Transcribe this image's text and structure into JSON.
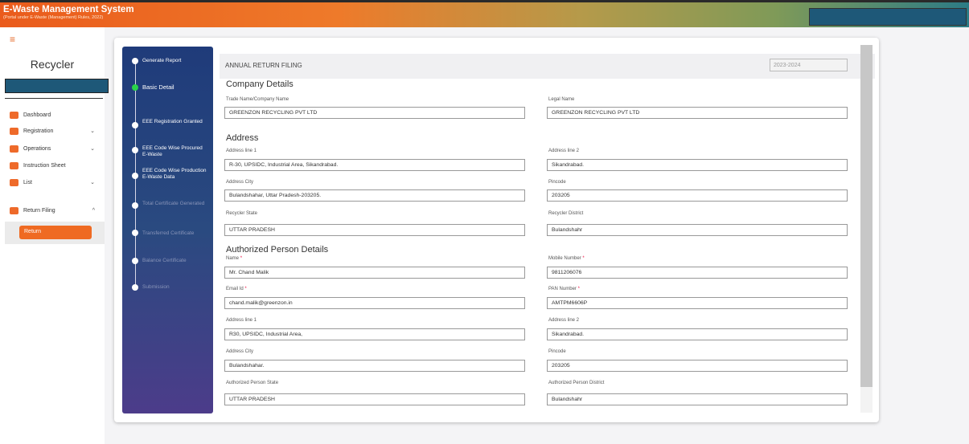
{
  "topbar": {
    "title": "E-Waste Management System",
    "subtitle": "(Portal under E-Waste (Management) Rules, 2022)"
  },
  "sidebar": {
    "menu_icon": "≡",
    "role": "Recycler",
    "items": [
      {
        "label": "Dashboard",
        "icon": "dashboard-icon"
      },
      {
        "label": "Registration",
        "icon": "envelope-icon",
        "chevron": "⌄"
      },
      {
        "label": "Operations",
        "icon": "grid-icon",
        "chevron": "⌄"
      },
      {
        "label": "Instruction Sheet",
        "icon": "sheet-icon"
      },
      {
        "label": "List",
        "icon": "folder-icon",
        "chevron": "⌄"
      },
      {
        "label": "Return Filing",
        "icon": "return-icon",
        "chevron": "^"
      }
    ],
    "sub_items": [
      {
        "label": "Return"
      }
    ]
  },
  "steps": [
    {
      "label": "Generate Report",
      "state": "done"
    },
    {
      "label": "Basic Detail",
      "state": "active"
    },
    {
      "label": "EEE Registration Granted",
      "state": "done"
    },
    {
      "label": "EEE Code Wise Procured E-Waste",
      "state": "done"
    },
    {
      "label": "EEE Code Wise Production E-Waste Data",
      "state": "done"
    },
    {
      "label": "Total Certificate Generated",
      "state": "pending"
    },
    {
      "label": "Transferred Certificate",
      "state": "pending"
    },
    {
      "label": "Balance Certificate",
      "state": "pending"
    },
    {
      "label": "Submission",
      "state": "pending"
    }
  ],
  "form": {
    "title": "ANNUAL RETURN FILING",
    "year": "2023-2024",
    "sections": {
      "company": "Company Details",
      "address": "Address",
      "authorized": "Authorized Person Details"
    },
    "fields": {
      "trade_name": {
        "label": "Trade Name/Company Name",
        "value": "GREENZON RECYCLING PVT LTD"
      },
      "legal_name": {
        "label": "Legal Name",
        "value": "GREENZON RECYCLING PVT LTD"
      },
      "address_line1": {
        "label": "Address line 1",
        "value": "R-30, UPSIDC, Industrial Area, Sikandrabad."
      },
      "address_line2": {
        "label": "Address line 2",
        "value": "Sikandrabad."
      },
      "address_city": {
        "label": "Address City",
        "value": "Bulandshahar, Uttar Pradesh-203205."
      },
      "pincode": {
        "label": "Pincode",
        "value": "203205"
      },
      "recycler_state": {
        "label": "Recycler State",
        "value": "UTTAR PRADESH"
      },
      "recycler_district": {
        "label": "Recycler District",
        "value": "Bulandshahr"
      },
      "name": {
        "label": "Name",
        "value": "Mr. Chand Malik"
      },
      "mobile": {
        "label": "Mobile Number",
        "value": "9811206076"
      },
      "email": {
        "label": "Email Id",
        "value": "chand.malik@greenzon.in"
      },
      "pan": {
        "label": "PAN Number",
        "value": "AMTPM6606P"
      },
      "ap_address_line1": {
        "label": "Address line 1",
        "value": "R30, UPSIDC, Industrial Area,"
      },
      "ap_address_line2": {
        "label": "Address line 2",
        "value": "Sikandrabad."
      },
      "ap_address_city": {
        "label": "Address City",
        "value": "Bulandshahar."
      },
      "ap_pincode": {
        "label": "Pincode",
        "value": "203205"
      },
      "ap_state": {
        "label": "Authorized Person State",
        "value": "UTTAR PRADESH"
      },
      "ap_district": {
        "label": "Authorized Person District",
        "value": "Bulandshahr"
      }
    },
    "required_mark": "*"
  },
  "colors": {
    "accent": "#ef6a22",
    "stepper_top": "#1f3b7a",
    "stepper_bottom": "#4c3c8a",
    "active_step": "#2ad44a",
    "redacted": "#1e5878"
  }
}
